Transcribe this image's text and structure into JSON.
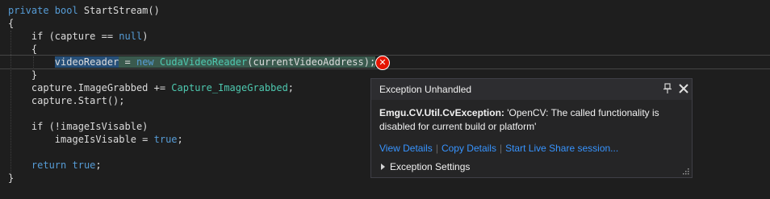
{
  "code": {
    "l1": {
      "kw": "private bool",
      "rest": " StartStream()"
    },
    "l2": "{",
    "l3": {
      "a": "    if (capture == ",
      "b": "null",
      "c": ")"
    },
    "l4": "    {",
    "l5": {
      "indent": "        ",
      "var": "videoReader",
      "eq": " = ",
      "kw": "new",
      "sp": " ",
      "ty": "CudaVideoReader",
      "args": "(currentVideoAddress);"
    },
    "l6": "    }",
    "l7": {
      "a": "    capture.ImageGrabbed += ",
      "b": "Capture_ImageGrabbed",
      "c": ";"
    },
    "l8": "    capture.Start();",
    "l9": "",
    "l10": "    if (!imageIsVisable)",
    "l11": {
      "a": "        imageIsVisable = ",
      "b": "true",
      "c": ";"
    },
    "l12": "",
    "l13": {
      "a": "    ",
      "b": "return",
      "c": " ",
      "d": "true",
      "e": ";"
    },
    "l14": "}"
  },
  "error_glyph": "✕",
  "exception": {
    "title": "Exception Unhandled",
    "type": "Emgu.CV.Util.CvException:",
    "message": " 'OpenCV: The called functionality is disabled for current build or platform'",
    "links": [
      "View Details",
      "Copy Details",
      "Start Live Share session..."
    ],
    "settings_label": "Exception Settings"
  },
  "colors": {
    "error_red": "#e51400",
    "link_blue": "#3794ff",
    "keyword": "#569cd6"
  }
}
